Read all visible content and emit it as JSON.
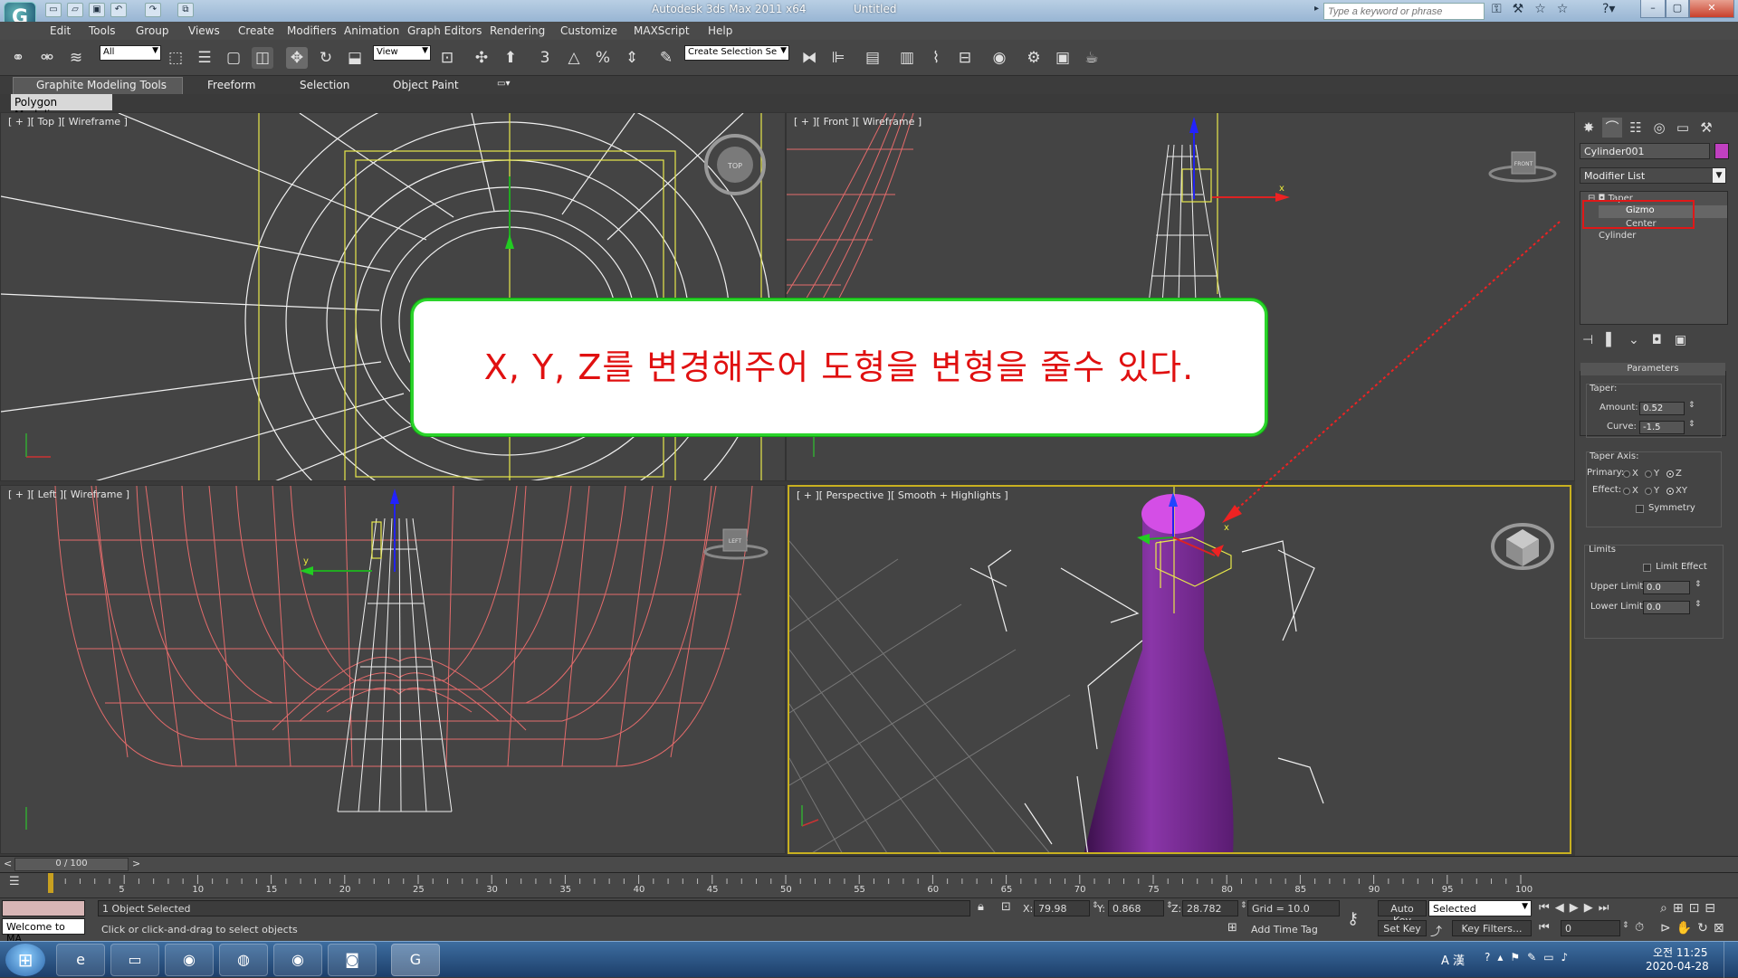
{
  "window": {
    "title": "Autodesk 3ds Max  2011 x64",
    "doc": "Untitled",
    "search_placeholder": "Type a keyword or phrase"
  },
  "menu": [
    "Edit",
    "Tools",
    "Group",
    "Views",
    "Create",
    "Modifiers",
    "Animation",
    "Graph Editors",
    "Rendering",
    "Customize",
    "MAXScript",
    "Help"
  ],
  "toolbar": {
    "filter": "All",
    "coord": "View",
    "named_selection": "Create Selection Se"
  },
  "ribbon": {
    "tabs": [
      "Graphite Modeling Tools",
      "Freeform",
      "Selection",
      "Object Paint"
    ],
    "panel": "Polygon Modeling"
  },
  "viewports": {
    "top": "[ + ][ Top ][ Wireframe ]",
    "front": "[ + ][ Front ][ Wireframe ]",
    "left": "[ + ][ Left ][ Wireframe ]",
    "persp": "[ + ][ Perspective ][ Smooth + Highlights ]",
    "cube_top": "TOP",
    "cube_front": "FRONT",
    "cube_left": "LEFT"
  },
  "callout": "X, Y, Z를 변경해주어 도형을 변형을 줄수 있다.",
  "command_panel": {
    "object_name": "Cylinder001",
    "object_color": "#c040c0",
    "modifier_list": "Modifier List",
    "stack": [
      "Taper",
      "Gizmo",
      "Center",
      "Cylinder"
    ],
    "parameters_title": "Parameters",
    "taper_label": "Taper:",
    "amount_label": "Amount:",
    "amount": "0.52",
    "curve_label": "Curve:",
    "curve": "-1.5",
    "taper_axis_label": "Taper Axis:",
    "primary_label": "Primary:",
    "effect_label": "Effect:",
    "primary_opts": [
      "X",
      "Y",
      "Z"
    ],
    "primary_selected": "Z",
    "effect_opts": [
      "X",
      "Y",
      "XY"
    ],
    "effect_selected": "XY",
    "symmetry": "Symmetry",
    "limits_label": "Limits",
    "limit_effect": "Limit Effect",
    "upper_limit_label": "Upper Limit:",
    "upper_limit": "0.0",
    "lower_limit_label": "Lower Limit:",
    "lower_limit": "0.0"
  },
  "timeline": {
    "frame": "0 / 100",
    "ticks": [
      "5",
      "10",
      "15",
      "20",
      "25",
      "30",
      "35",
      "40",
      "45",
      "50",
      "55",
      "60",
      "65",
      "70",
      "75",
      "80",
      "85",
      "90",
      "95",
      "100"
    ]
  },
  "status": {
    "listener": "Welcome to MA",
    "selected": "1 Object Selected",
    "prompt": "Click or click-and-drag to select objects",
    "x_label": "X:",
    "x": "79.98",
    "y_label": "Y:",
    "y": "0.868",
    "z_label": "Z:",
    "z": "28.782",
    "grid": "Grid = 10.0",
    "add_time_tag": "Add Time Tag",
    "auto_key": "Auto Key",
    "set_key": "Set Key",
    "key_mode": "Selected",
    "key_filters": "Key Filters...",
    "frame_field": "0"
  },
  "taskbar": {
    "clock_time": "오전 11:25",
    "clock_date": "2020-04-28",
    "ime": "A 漢"
  }
}
